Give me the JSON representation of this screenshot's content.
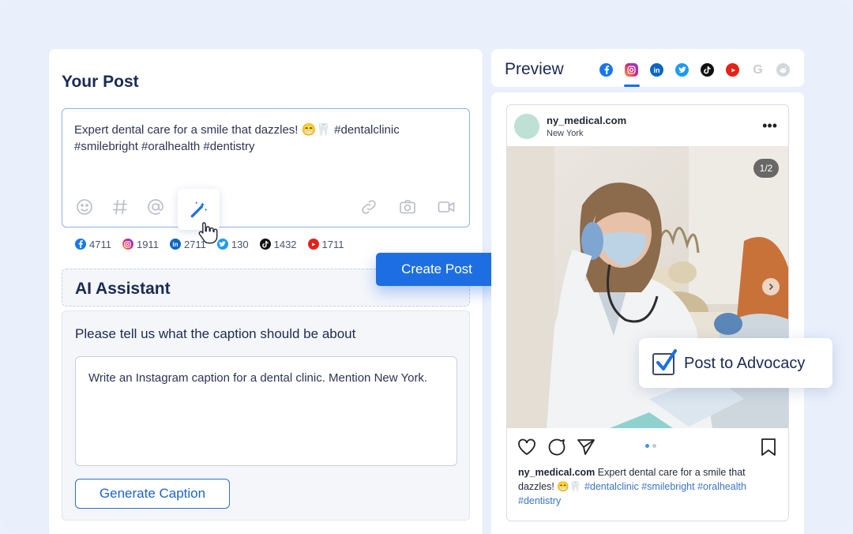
{
  "your_post": {
    "title": "Your Post",
    "text": "Expert dental care for a smile that dazzles! 😁🦷 #dentalclinic #smilebright #oralhealth #dentistry",
    "tools": [
      "emoji-icon",
      "hashtag-icon",
      "mention-icon",
      "magic-wand-icon",
      "link-icon",
      "camera-icon",
      "video-icon"
    ],
    "counts": [
      {
        "network": "facebook",
        "value": "4711",
        "color": "#1877f2"
      },
      {
        "network": "instagram",
        "value": "1911",
        "color": "#d62976"
      },
      {
        "network": "linkedin",
        "value": "2711",
        "color": "#0a66c2"
      },
      {
        "network": "twitter",
        "value": "130",
        "color": "#1d9bf0"
      },
      {
        "network": "tiktok",
        "value": "1432",
        "color": "#111111"
      },
      {
        "network": "youtube",
        "value": "1711",
        "color": "#e62117"
      }
    ]
  },
  "create_post_label": "Create Post",
  "ai_assistant": {
    "title": "AI Assistant",
    "question": "Please tell us what the caption should be about",
    "prompt_value": "Write an Instagram caption for a dental clinic. Mention New York.",
    "generate_label": "Generate Caption"
  },
  "preview": {
    "title": "Preview",
    "networks": [
      "facebook",
      "instagram",
      "linkedin",
      "twitter",
      "tiktok",
      "youtube",
      "google",
      "reddit"
    ],
    "selected_network": "instagram",
    "post": {
      "handle": "ny_medical.com",
      "location": "New York",
      "page_indicator": "1/2",
      "caption_handle": "ny_medical.com",
      "caption_text": " Expert dental care for a smile that dazzles! 😁🦷 ",
      "caption_tags": "#dentalclinic #smilebright #oralhealth #dentistry"
    }
  },
  "advocacy": {
    "label": "Post to Advocacy",
    "checked": true
  },
  "colors": {
    "accent": "#1d6ee3",
    "background": "#e9f0fc"
  }
}
